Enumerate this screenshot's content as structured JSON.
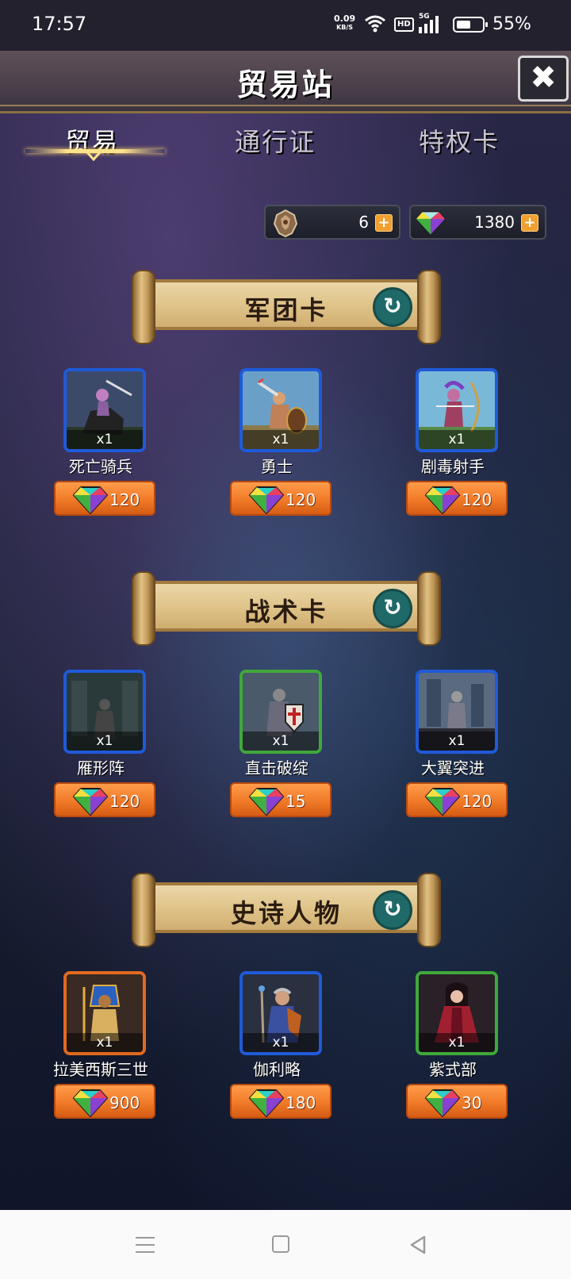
{
  "status_bar": {
    "time": "17:57",
    "net_speed_value": "0.09",
    "net_speed_unit": "KB/S",
    "hd": "HD",
    "network": "5G",
    "battery": "55%"
  },
  "header": {
    "title": "贸易站",
    "close_icon": "close-icon"
  },
  "tabs": [
    {
      "label": "贸易",
      "active": true
    },
    {
      "label": "通行证",
      "active": false
    },
    {
      "label": "特权卡",
      "active": false
    }
  ],
  "currency": [
    {
      "icon": "crest-icon",
      "amount": "6"
    },
    {
      "icon": "gem-icon",
      "amount": "1380"
    }
  ],
  "sections": [
    {
      "title": "军团卡",
      "items": [
        {
          "name": "死亡骑兵",
          "count": "x1",
          "price": "120",
          "frame": "#1f5ad8"
        },
        {
          "name": "勇士",
          "count": "x1",
          "price": "120",
          "frame": "#1f5ad8"
        },
        {
          "name": "剧毒射手",
          "count": "x1",
          "price": "120",
          "frame": "#1f5ad8"
        }
      ]
    },
    {
      "title": "战术卡",
      "items": [
        {
          "name": "雁形阵",
          "count": "x1",
          "price": "120",
          "frame": "#1f5ad8"
        },
        {
          "name": "直击破绽",
          "count": "x1",
          "price": "15",
          "frame": "#3fa83a"
        },
        {
          "name": "大翼突进",
          "count": "x1",
          "price": "120",
          "frame": "#1f5ad8"
        }
      ]
    },
    {
      "title": "史诗人物",
      "items": [
        {
          "name": "拉美西斯三世",
          "count": "x1",
          "price": "900",
          "frame": "#e16a20"
        },
        {
          "name": "伽利略",
          "count": "x1",
          "price": "180",
          "frame": "#1f5ad8"
        },
        {
          "name": "紫式部",
          "count": "x1",
          "price": "30",
          "frame": "#3fa83a"
        }
      ]
    }
  ],
  "colors": {
    "accent_gold": "#ffe38a",
    "price_orange": "#f07a28",
    "refresh_teal": "#1f6a68"
  }
}
